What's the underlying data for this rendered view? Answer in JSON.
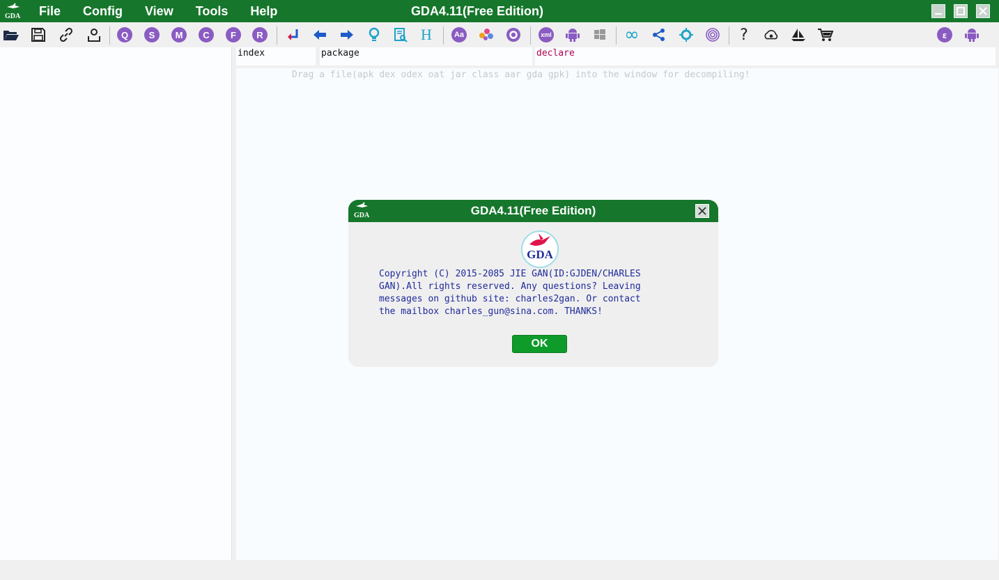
{
  "app": {
    "title": "GDA4.11(Free Edition)",
    "menu": [
      {
        "label": "File"
      },
      {
        "label": "Config"
      },
      {
        "label": "View"
      },
      {
        "label": "Tools"
      },
      {
        "label": "Help"
      }
    ]
  },
  "toolbar": {
    "circle_buttons": [
      {
        "letter": "Q"
      },
      {
        "letter": "S"
      },
      {
        "letter": "M"
      },
      {
        "letter": "C"
      },
      {
        "letter": "F"
      },
      {
        "letter": "R"
      }
    ],
    "aa_label": "Aa",
    "xml_label": "xml",
    "help_label": "?",
    "epsilon_label": "ε",
    "h_label": "H"
  },
  "columns": {
    "index": "index",
    "package": "package",
    "declare": "declare"
  },
  "main": {
    "drop_hint": "Drag a file(apk dex odex oat jar class aar gda gpk) into the window for decompiling!"
  },
  "dialog": {
    "title": "GDA4.11(Free Edition)",
    "logo_text": "GDA",
    "message_lines": [
      "Copyright (C) 2015-2085 JIE GAN(ID:GJDEN/CHARLES",
      "GAN).All rights reserved. Any questions? Leaving",
      "messages on github site: charles2gan. Or contact",
      "the mailbox charles_gun@sina.com. THANKS!"
    ],
    "ok_label": "OK"
  },
  "colors": {
    "title_green": "#16772c",
    "ok_green": "#0f9b2a",
    "circle_purple": "#8a5cc2",
    "text_blue": "#1f2a9a",
    "declare_red": "#b0004f"
  }
}
